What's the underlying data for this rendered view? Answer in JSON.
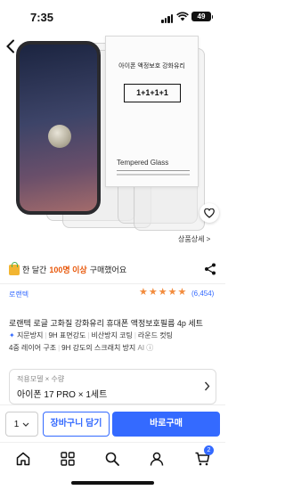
{
  "status_bar": {
    "time": "7:35",
    "battery": "49"
  },
  "product": {
    "box_title": "아이폰 액정보호 강화유리",
    "box_count": "1+1+1+1",
    "box_brand": "Tempered Glass",
    "detail_link": "상품상세 >"
  },
  "social_proof": {
    "prefix": "한 달간 ",
    "count": "100명 이상",
    "suffix": " 구매했어요"
  },
  "brand": "로랜텍",
  "rating": {
    "stars": 5,
    "max": 5,
    "reviews": "(6,454)"
  },
  "title": "로랜텍 로글 고화질 강화유리 휴대폰 액정보호필름 4p 세트",
  "features_line1": [
    "지문방지",
    "9H 표면강도",
    "비산방지 코팅",
    "라운드 컷팅"
  ],
  "features_line2": [
    "4중 레이어 구조",
    "9H 강도의 스크래치 방지"
  ],
  "ai_label": "AI ⓘ",
  "ai_spark": "✦",
  "option": {
    "label": "적용모델 × 수량",
    "value": "아이폰 17 PRO × 1세트"
  },
  "buy_bar": {
    "qty": "1",
    "cart_label": "장바구니 담기",
    "buy_label": "바로구매"
  },
  "tab_bar": {
    "cart_badge": "2"
  },
  "colors": {
    "accent": "#346aff",
    "star": "#f28b3c",
    "highlight": "#e8590c"
  }
}
